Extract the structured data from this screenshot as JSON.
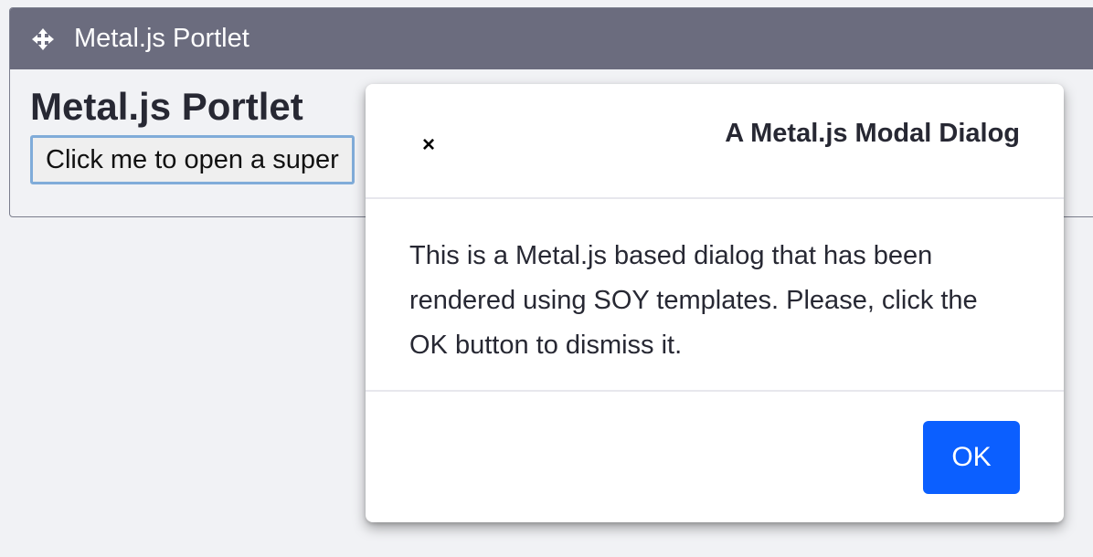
{
  "portlet": {
    "topper_title": "Metal.js Portlet",
    "heading": "Metal.js Portlet",
    "open_button_label": "Click me to open a super"
  },
  "modal": {
    "close_symbol": "×",
    "title": "A Metal.js Modal Dialog",
    "body_text": "This is a Metal.js based dialog that has been rendered using SOY templates. Please, click the OK button to dismiss it.",
    "ok_label": "OK"
  },
  "icons": {
    "move": "move-arrows-icon",
    "close": "close-icon"
  },
  "colors": {
    "topper_bg": "#6b6c7e",
    "primary": "#0b5fff",
    "page_bg": "#f1f2f5"
  }
}
